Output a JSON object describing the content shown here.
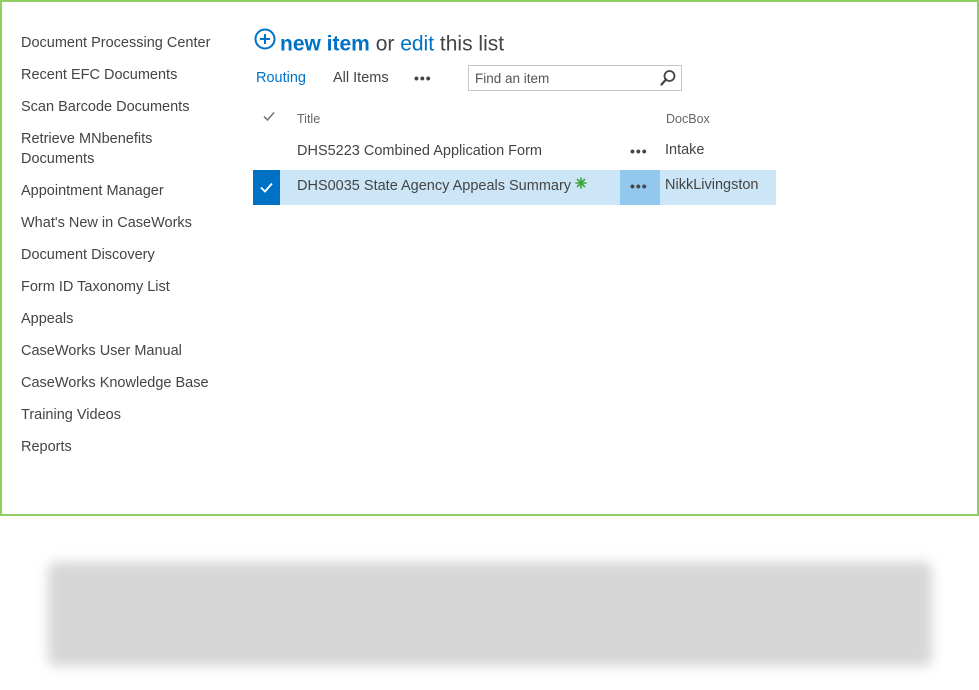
{
  "nav": {
    "items": [
      {
        "label": "Document Processing Center"
      },
      {
        "label": "Recent EFC Documents"
      },
      {
        "label": "Scan Barcode Documents"
      },
      {
        "label": "Retrieve MNbenefits Documents"
      },
      {
        "label": "Appointment Manager"
      },
      {
        "label": "What's New in CaseWorks"
      },
      {
        "label": "Document Discovery"
      },
      {
        "label": "Form ID Taxonomy List"
      },
      {
        "label": "Appeals"
      },
      {
        "label": "CaseWorks User Manual"
      },
      {
        "label": "CaseWorks Knowledge Base"
      },
      {
        "label": "Training Videos"
      },
      {
        "label": "Reports"
      }
    ]
  },
  "headline": {
    "new_item": "new item",
    "or": " or ",
    "edit": "edit",
    "this_list": " this list",
    "plus_icon": "circle-plus-icon"
  },
  "views": {
    "active": "Routing",
    "other": "All Items",
    "more": "•••"
  },
  "search": {
    "placeholder": "Find an item",
    "icon": "search-icon"
  },
  "table": {
    "columns": {
      "title": "Title",
      "docbox": "DocBox"
    },
    "rows": [
      {
        "title": "DHS5223 Combined Application Form",
        "docbox": "Intake",
        "selected": false,
        "is_new": false
      },
      {
        "title": "DHS0035 State Agency Appeals Summary",
        "docbox": "NikkLivingston",
        "selected": true,
        "is_new": true
      }
    ],
    "row_menu": "•••"
  },
  "colors": {
    "accent": "#0072c6",
    "selected_row": "#cde6f7",
    "frame_border": "#8fcf62",
    "new_badge": "#3ba53b"
  }
}
